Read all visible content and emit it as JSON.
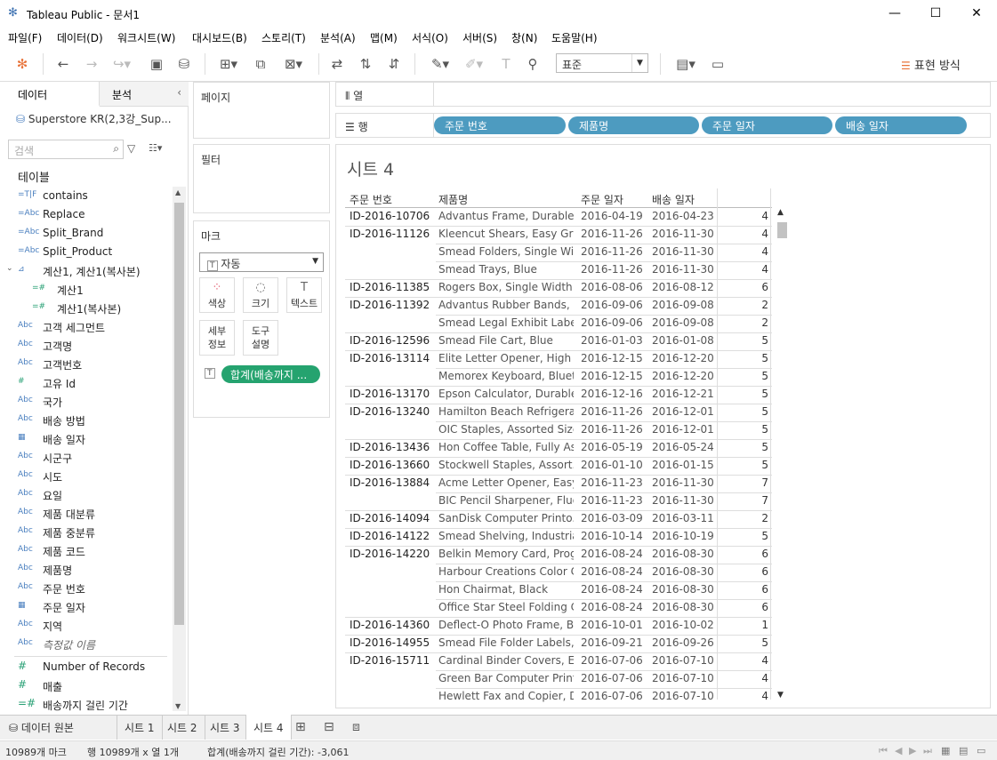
{
  "window": {
    "title": "Tableau Public - 문서1"
  },
  "menu": [
    "파일(F)",
    "데이터(D)",
    "워크시트(W)",
    "대시보드(B)",
    "스토리(T)",
    "분석(A)",
    "맵(M)",
    "서식(O)",
    "서버(S)",
    "창(N)",
    "도움말(H)"
  ],
  "toolbar": {
    "format_select": "표준",
    "show_me": "표현 방식"
  },
  "left_pane": {
    "tab_data": "데이터",
    "tab_analysis": "분석",
    "datasource": "Superstore KR(2,3강_Sup...",
    "search_placeholder": "검색",
    "tables_heading": "테이블",
    "fields": [
      {
        "icon": "=T|F",
        "label": "contains"
      },
      {
        "icon": "=Abc",
        "label": "Replace"
      },
      {
        "icon": "=Abc",
        "label": "Split_Brand"
      },
      {
        "icon": "=Abc",
        "label": "Split_Product"
      },
      {
        "icon": "hier",
        "label": "계산1, 계산1(복사본)"
      },
      {
        "icon": "=#",
        "label": "계산1"
      },
      {
        "icon": "=#",
        "label": "계산1(복사본)"
      },
      {
        "icon": "Abc",
        "label": "고객 세그먼트"
      },
      {
        "icon": "Abc",
        "label": "고객명"
      },
      {
        "icon": "Abc",
        "label": "고객번호"
      },
      {
        "icon": "#",
        "label": "고유 Id"
      },
      {
        "icon": "Abc",
        "label": "국가"
      },
      {
        "icon": "Abc",
        "label": "배송 방법"
      },
      {
        "icon": "cal",
        "label": "배송 일자"
      },
      {
        "icon": "Abc",
        "label": "시군구"
      },
      {
        "icon": "Abc",
        "label": "시도"
      },
      {
        "icon": "Abc",
        "label": "요일"
      },
      {
        "icon": "Abc",
        "label": "제품 대분류"
      },
      {
        "icon": "Abc",
        "label": "제품 중분류"
      },
      {
        "icon": "Abc",
        "label": "제품 코드"
      },
      {
        "icon": "Abc",
        "label": "제품명"
      },
      {
        "icon": "Abc",
        "label": "주문 번호"
      },
      {
        "icon": "cal",
        "label": "주문 일자"
      },
      {
        "icon": "Abc",
        "label": "지역"
      },
      {
        "icon": "Abc",
        "label": "측정값 이름"
      }
    ],
    "measures": [
      {
        "icon": "#",
        "label": "Number of Records"
      },
      {
        "icon": "#",
        "label": "매출"
      },
      {
        "icon": "=#",
        "label": "배송까지 걸린 기간"
      }
    ]
  },
  "cards": {
    "pages": "페이지",
    "filters": "필터",
    "marks": "마크",
    "mark_type": "자동",
    "buttons": [
      "색상",
      "크기",
      "텍스트",
      "세부\n정보",
      "도구\n설명"
    ],
    "measure_pill": "합계(배송까지 ..."
  },
  "shelves": {
    "columns_label": "열",
    "rows_label": "행",
    "row_pills": [
      "주문 번호",
      "제품명",
      "주문 일자",
      "배송 일자"
    ]
  },
  "view": {
    "sheet_title": "시트 4",
    "headers": [
      "주문 번호",
      "제품명",
      "주문 일자",
      "배송 일자"
    ],
    "rows": [
      [
        "ID-2016-10706",
        "Advantus Frame, Durable",
        "2016-04-19",
        "2016-04-23",
        "4"
      ],
      [
        "ID-2016-11126",
        "Kleencut Shears, Easy Grip",
        "2016-11-26",
        "2016-11-30",
        "4"
      ],
      [
        "",
        "Smead Folders, Single Wi...",
        "2016-11-26",
        "2016-11-30",
        "4"
      ],
      [
        "",
        "Smead Trays, Blue",
        "2016-11-26",
        "2016-11-30",
        "4"
      ],
      [
        "ID-2016-11385",
        "Rogers Box, Single Width",
        "2016-08-06",
        "2016-08-12",
        "6"
      ],
      [
        "ID-2016-11392",
        "Advantus Rubber Bands, ..",
        "2016-09-06",
        "2016-09-08",
        "2"
      ],
      [
        "",
        "Smead Legal Exhibit Label..",
        "2016-09-06",
        "2016-09-08",
        "2"
      ],
      [
        "ID-2016-12596",
        "Smead File Cart, Blue",
        "2016-01-03",
        "2016-01-08",
        "5"
      ],
      [
        "ID-2016-13114",
        "Elite Letter Opener, High ..",
        "2016-12-15",
        "2016-12-20",
        "5"
      ],
      [
        "",
        "Memorex Keyboard, Bluet..",
        "2016-12-15",
        "2016-12-20",
        "5"
      ],
      [
        "ID-2016-13170",
        "Epson Calculator, Durable",
        "2016-12-16",
        "2016-12-21",
        "5"
      ],
      [
        "ID-2016-13240",
        "Hamilton Beach Refrigera..",
        "2016-11-26",
        "2016-12-01",
        "5"
      ],
      [
        "",
        "OIC Staples, Assorted Sizes",
        "2016-11-26",
        "2016-12-01",
        "5"
      ],
      [
        "ID-2016-13436",
        "Hon Coffee Table, Fully As..",
        "2016-05-19",
        "2016-05-24",
        "5"
      ],
      [
        "ID-2016-13660",
        "Stockwell Staples, Assort..",
        "2016-01-10",
        "2016-01-15",
        "5"
      ],
      [
        "ID-2016-13884",
        "Acme Letter Opener, Easy..",
        "2016-11-23",
        "2016-11-30",
        "7"
      ],
      [
        "",
        "BIC Pencil Sharpener, Fluo..",
        "2016-11-23",
        "2016-11-30",
        "7"
      ],
      [
        "ID-2016-14094",
        "SanDisk Computer Printo..",
        "2016-03-09",
        "2016-03-11",
        "2"
      ],
      [
        "ID-2016-14122",
        "Smead Shelving, Industrial",
        "2016-10-14",
        "2016-10-19",
        "5"
      ],
      [
        "ID-2016-14220",
        "Belkin Memory Card, Prog..",
        "2016-08-24",
        "2016-08-30",
        "6"
      ],
      [
        "",
        "Harbour Creations Color C..",
        "2016-08-24",
        "2016-08-30",
        "6"
      ],
      [
        "",
        "Hon Chairmat, Black",
        "2016-08-24",
        "2016-08-30",
        "6"
      ],
      [
        "",
        "Office Star Steel Folding C..",
        "2016-08-24",
        "2016-08-30",
        "6"
      ],
      [
        "ID-2016-14360",
        "Deflect-O Photo Frame, Bl..",
        "2016-10-01",
        "2016-10-02",
        "1"
      ],
      [
        "ID-2016-14955",
        "Smead File Folder Labels, ..",
        "2016-09-21",
        "2016-09-26",
        "5"
      ],
      [
        "ID-2016-15711",
        "Cardinal Binder Covers, Ec..",
        "2016-07-06",
        "2016-07-10",
        "4"
      ],
      [
        "",
        "Green Bar Computer Print..",
        "2016-07-06",
        "2016-07-10",
        "4"
      ],
      [
        "",
        "Hewlett Fax and Copier, D..",
        "2016-07-06",
        "2016-07-10",
        "4"
      ]
    ]
  },
  "sheet_tabs": {
    "datasource": "데이터 원본",
    "tabs": [
      "시트 1",
      "시트 2",
      "시트 3",
      "시트 4"
    ],
    "active": "시트 4"
  },
  "status": {
    "marks": "10989개 마크",
    "rows_cols": "행 10989개  x  열 1개",
    "sum": "합계(배송까지 걸린 기간): -3,061"
  }
}
